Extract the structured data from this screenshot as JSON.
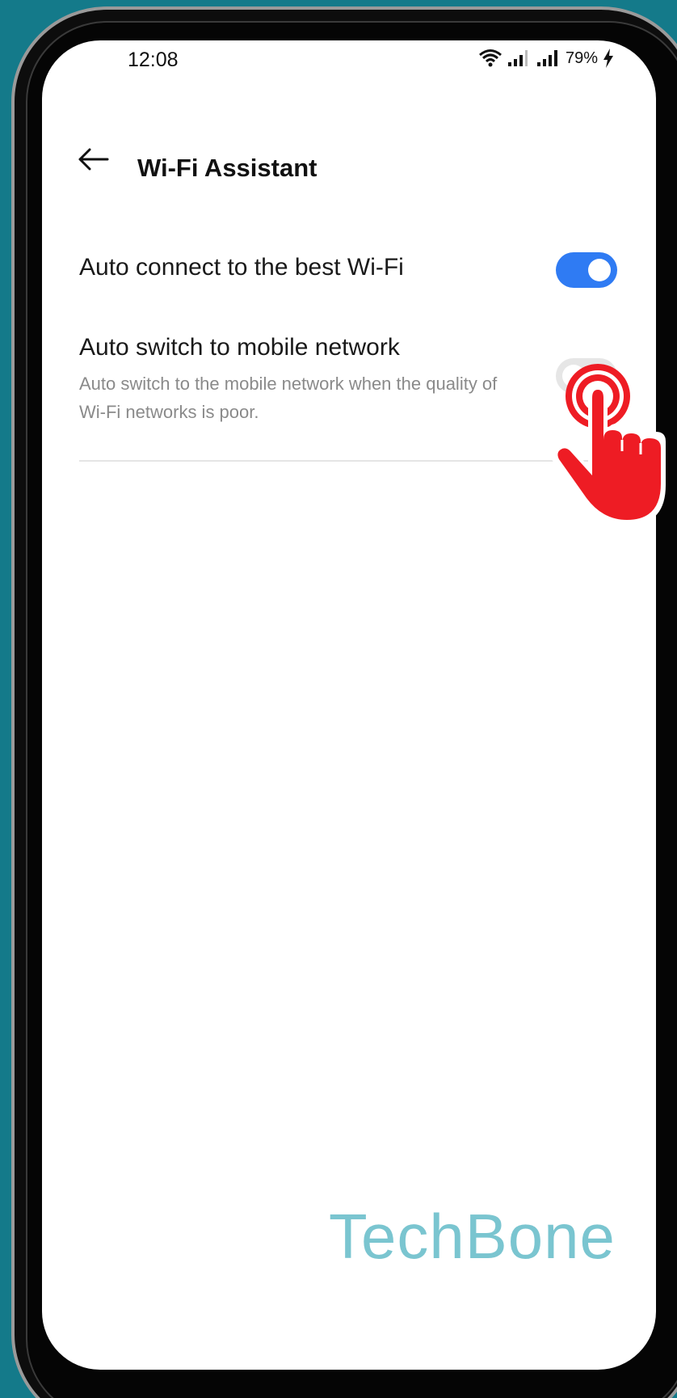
{
  "status_bar": {
    "time": "12:08",
    "battery": "79%",
    "icons": [
      "wifi-icon",
      "signal-icon",
      "signal-icon",
      "charging-icon"
    ]
  },
  "header": {
    "title": "Wi-Fi Assistant",
    "back_icon": "arrow-left-icon"
  },
  "settings": [
    {
      "label": "Auto connect to the best Wi-Fi",
      "description": "",
      "enabled": true
    },
    {
      "label": "Auto switch to mobile network",
      "description": "Auto switch to the mobile network when the quality of Wi-Fi networks is poor.",
      "enabled": false
    }
  ],
  "watermark": "TechBone",
  "colors": {
    "background": "#147a8a",
    "toggle_on": "#2f7bf3",
    "toggle_off": "#e6e6e6",
    "pointer": "#ee1c24",
    "watermark": "#7ac5d0"
  }
}
